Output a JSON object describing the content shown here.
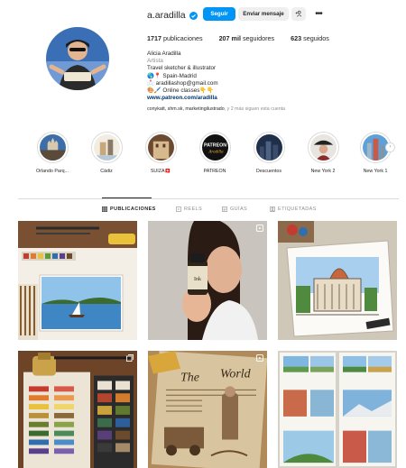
{
  "profile": {
    "username": "a.aradilla",
    "verified": true,
    "buttons": {
      "follow": "Seguir",
      "message": "Enviar mensaje",
      "suggest": "+A",
      "more": "•••"
    }
  },
  "stats": {
    "posts_count": "1717",
    "posts_label": "publicaciones",
    "followers_count": "207 mil",
    "followers_label": "seguidores",
    "following_count": "623",
    "following_label": "seguidos"
  },
  "bio": {
    "name": "Alicia Aradilla",
    "category": "Artista",
    "line1": "Travel sketcher & illustrator",
    "line2": "🌎📍 Spain-Madrid",
    "line3": "📩 aradillashop@gmail.com",
    "line4": "🎨🖌️ Online classes👇👇",
    "link": "www.patreon.com/aradilla"
  },
  "followed_by": {
    "names": "conykatt, shm.sk, marketingilustrado",
    "rest": ", y 2 más siguen esta cuenta"
  },
  "highlights": [
    {
      "label": "Orlando Parq...",
      "icon": "castle"
    },
    {
      "label": "Cádiz",
      "icon": "city-sketch"
    },
    {
      "label": "SUIZA🇨🇭",
      "icon": "building"
    },
    {
      "label": "PATREON",
      "icon": "patreon-logo"
    },
    {
      "label": "Descuentos",
      "icon": "city-night"
    },
    {
      "label": "New York 2",
      "icon": "portrait"
    },
    {
      "label": "New York 1",
      "icon": "skyline"
    }
  ],
  "tabs": [
    {
      "label": "PUBLICACIONES",
      "icon": "grid-icon",
      "active": true
    },
    {
      "label": "REELS",
      "icon": "reels-icon",
      "active": false
    },
    {
      "label": "GUÍAS",
      "icon": "guides-icon",
      "active": false
    },
    {
      "label": "ETIQUETADAS",
      "icon": "tagged-icon",
      "active": false
    }
  ],
  "posts": [
    {
      "subject": "watercolor painting of lake with palette",
      "badge": "none"
    },
    {
      "subject": "woman holding ink bottle",
      "badge": "reel-icon"
    },
    {
      "subject": "watercolor sketch of cathedral",
      "badge": "none"
    },
    {
      "subject": "watercolor swatches with paintbox",
      "badge": "multiple-icon"
    },
    {
      "subject": "sepia newspaper illustration",
      "badge": "reel-icon"
    },
    {
      "subject": "sketchbook pages with watercolor landscapes",
      "badge": "none"
    }
  ],
  "colors": {
    "accent": "#0095f6",
    "text": "#262626",
    "secondary": "#8e8e8e",
    "link": "#00376b",
    "border": "#dbdbdb"
  }
}
